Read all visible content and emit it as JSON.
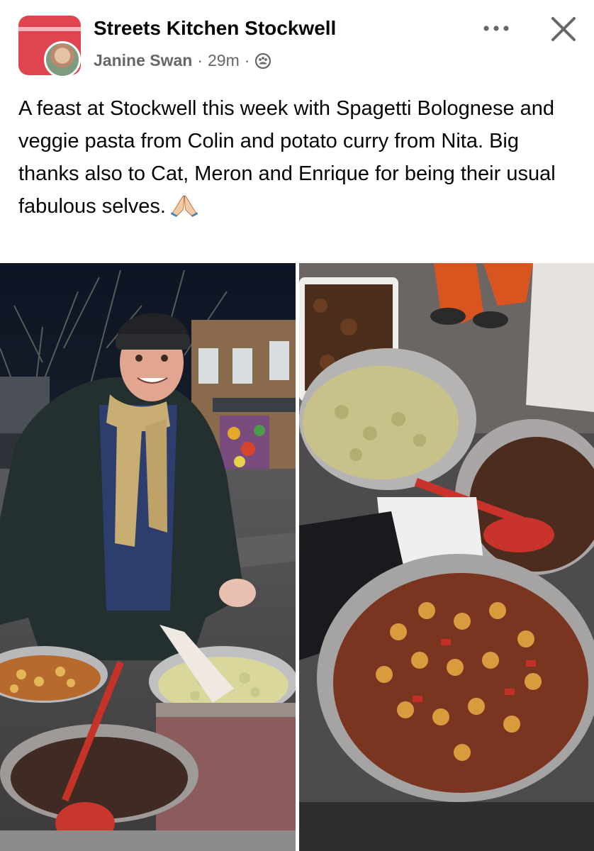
{
  "header": {
    "group_name": "Streets Kitchen Stockwell",
    "author": "Janine Swan",
    "separator": "·",
    "time": "29m",
    "audience_icon": "group-audience-icon",
    "more_icon": "more-options-icon",
    "close_icon": "close-icon"
  },
  "post": {
    "text": "A feast at Stockwell this week with Spagetti Bolognese and veggie pasta from Colin and potato curry from Nita. Big thanks also to Cat, Meron and Enrique for being their usual fabulous selves.",
    "emoji": "folded-hands-emoji"
  },
  "photos": [
    "photo-left",
    "photo-right"
  ],
  "colors": {
    "text": "#050505",
    "secondary_text": "#65676b",
    "group_avatar": "#e0444f"
  }
}
